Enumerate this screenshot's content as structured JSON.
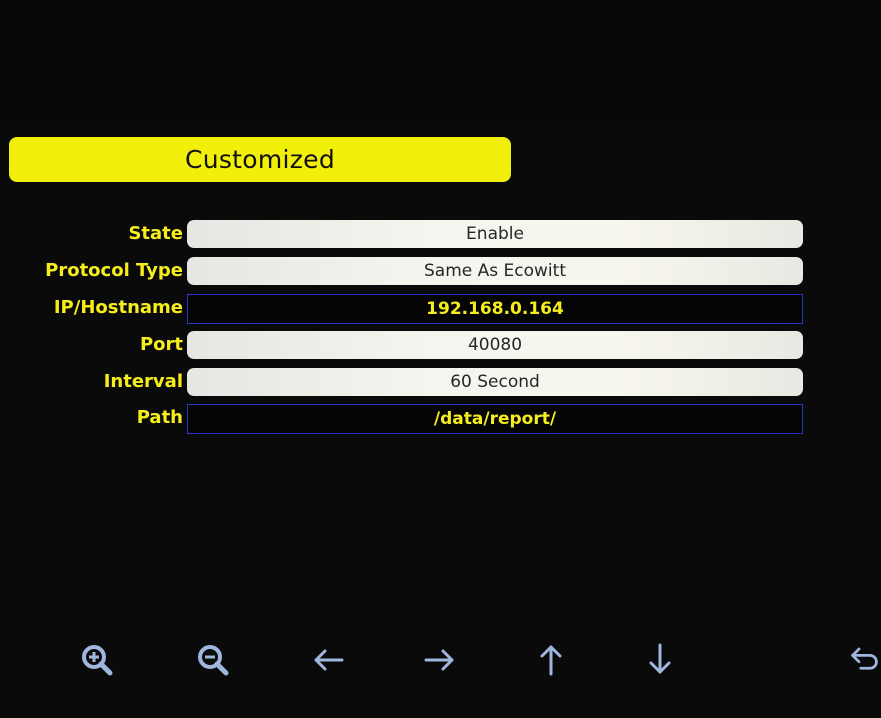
{
  "header": {
    "title": "Customized"
  },
  "settings": [
    {
      "label": "State",
      "value": "Enable",
      "kind": "select"
    },
    {
      "label": "Protocol Type",
      "value": "Same As Ecowitt",
      "kind": "select"
    },
    {
      "label": "IP/Hostname",
      "value": "192.168.0.164",
      "kind": "text"
    },
    {
      "label": "Port",
      "value": "40080",
      "kind": "select"
    },
    {
      "label": "Interval",
      "value": "60 Second",
      "kind": "select"
    },
    {
      "label": "Path",
      "value": "/data/report/",
      "kind": "text"
    }
  ],
  "toolbar": {
    "icons": [
      "zoom-in-icon",
      "zoom-out-icon",
      "arrow-left-icon",
      "arrow-right-icon",
      "arrow-up-icon",
      "arrow-down-icon",
      "return-icon"
    ]
  },
  "colors": {
    "accent": "#f2ef0a",
    "label_text": "#f5ee1c",
    "input_border": "#2336c8",
    "icon": "#9fb6de",
    "background": "#070707"
  }
}
